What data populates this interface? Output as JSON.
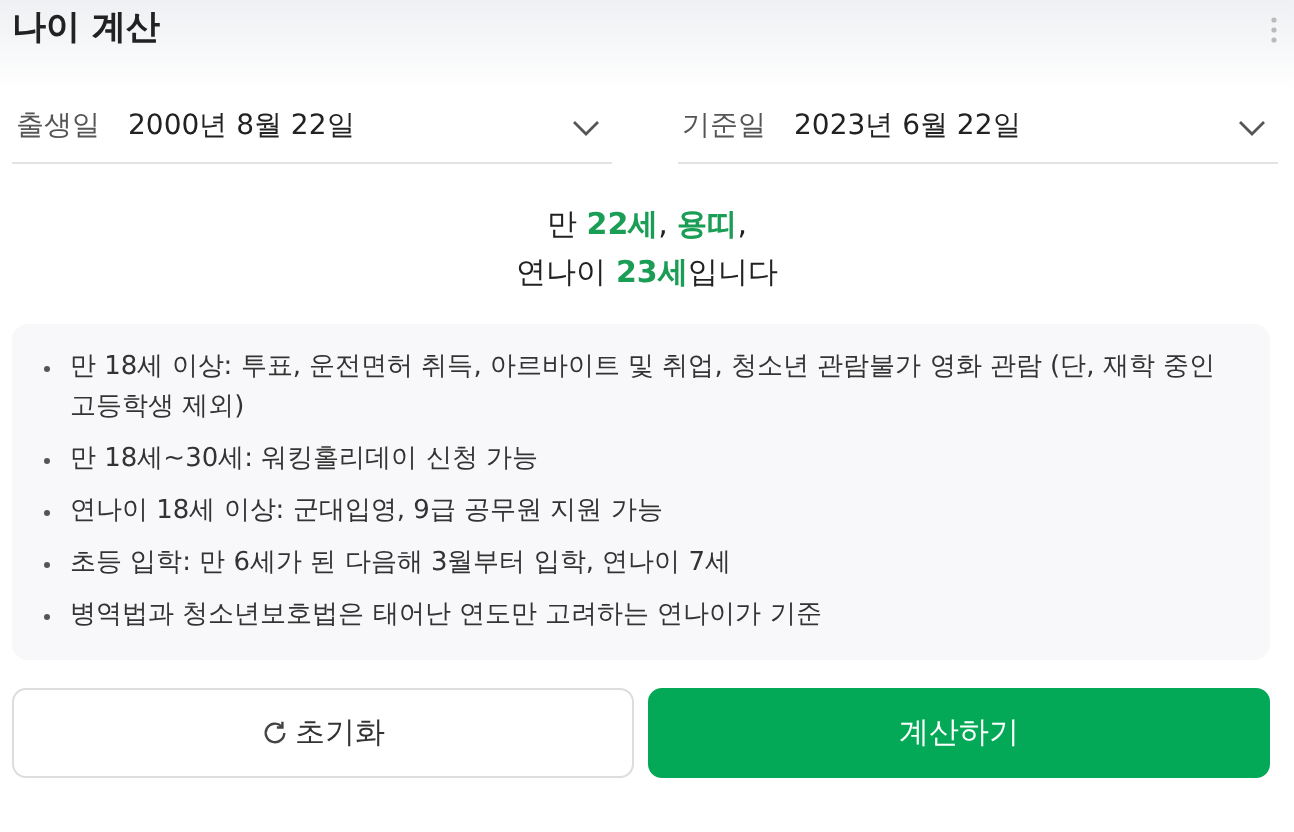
{
  "header": {
    "title": "나이 계산"
  },
  "fields": [
    {
      "label": "출생일",
      "value": "2000년 8월 22일"
    },
    {
      "label": "기준일",
      "value": "2023년 6월 22일"
    }
  ],
  "result": {
    "lines": [
      "만 **22세**, **용띠**,",
      "연나이 **23세**입니다"
    ]
  },
  "notes": [
    "만 18세 이상: 투표, 운전면허 취득, 아르바이트 및 취업, 청소년 관람불가 영화 관람 (단, 재학 중인 고등학생 제외)",
    "만 18세~30세: 워킹홀리데이 신청 가능",
    "연나이 18세 이상: 군대입영, 9급 공무원 지원 가능",
    "초등 입학: 만 6세가 된 다음해 3월부터 입학, 연나이 7세",
    "병역법과 청소년보호법은 태어난 연도만 고려하는 연나이가 기준"
  ],
  "buttons": [
    {
      "label": "초기화",
      "kind": "secondary"
    },
    {
      "label": "계산하기",
      "kind": "primary"
    }
  ]
}
